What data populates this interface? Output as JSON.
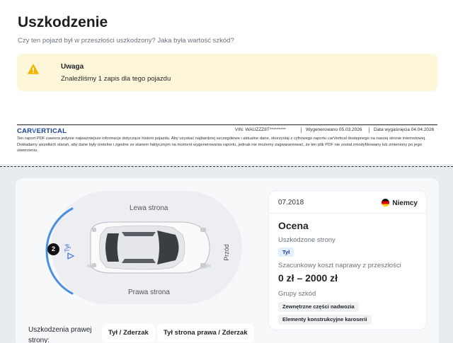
{
  "header": {
    "title": "Uszkodzenie",
    "subtitle": "Czy ten pojazd był w przeszłości uszkodzony? Jaka była wartość szkód?"
  },
  "alert": {
    "title": "Uwaga",
    "text": "Znaleźliśmy 1 zapis dla tego pojazdu",
    "icon": "warning-icon",
    "color": "#f4b400"
  },
  "report_footer": {
    "brand_a": "CAR",
    "brand_v": "V",
    "brand_b": "ERTICAL",
    "vin": "VIN:  WAUZZZ8T*********",
    "generated": "Wygenerowano  05.03.2026",
    "expires": "Data wygaśnięcia  04.04.2026",
    "disclaimer": "Ten raport PDF zawiera jedynie najważniejsze informacje dotyczące historii pojazdu. Aby uzyskać najbardziej szczegółowe i aktualne dane, skorzystaj z cyfrowego raportu carVertical dostępnego na naszej stronie internetowej. Dokładamy wszelkich starań, aby dane były rzetelne i zgodne ze stanem faktycznym na moment wygenerowania raportu, jednak nie możemy zagwarantować, że ten plik PDF nie został zmodyfikowany lub zmieniony po jego utworzeniu."
  },
  "diagram": {
    "left_side": "Lewa strona",
    "right_side": "Prawa strona",
    "front": "Przód",
    "rear": "Tył",
    "count": "2"
  },
  "damage_row": {
    "label": "Uszkodzenia prawej strony:",
    "chips": [
      "Tył / Zderzak",
      "Tył strona prawa / Zderzak"
    ]
  },
  "record": {
    "date": "07.2018",
    "country": "Niemcy",
    "assessment_title": "Ocena",
    "damaged_sides_label": "Uszkodzone strony",
    "damaged_side_tag": "Tył",
    "repair_cost_label": "Szacunkowy koszt naprawy z przeszłości",
    "repair_cost": "0 zł – 2000 zł",
    "groups_label": "Grupy szkód",
    "groups": [
      "Zewnętrzne części nadwozia",
      "Elementy konstrukcyjne karoserii"
    ]
  },
  "colors": {
    "accent_blue": "#4a90e2",
    "alert_bg": "#fdf6d8",
    "brand": "#1c3f94"
  }
}
